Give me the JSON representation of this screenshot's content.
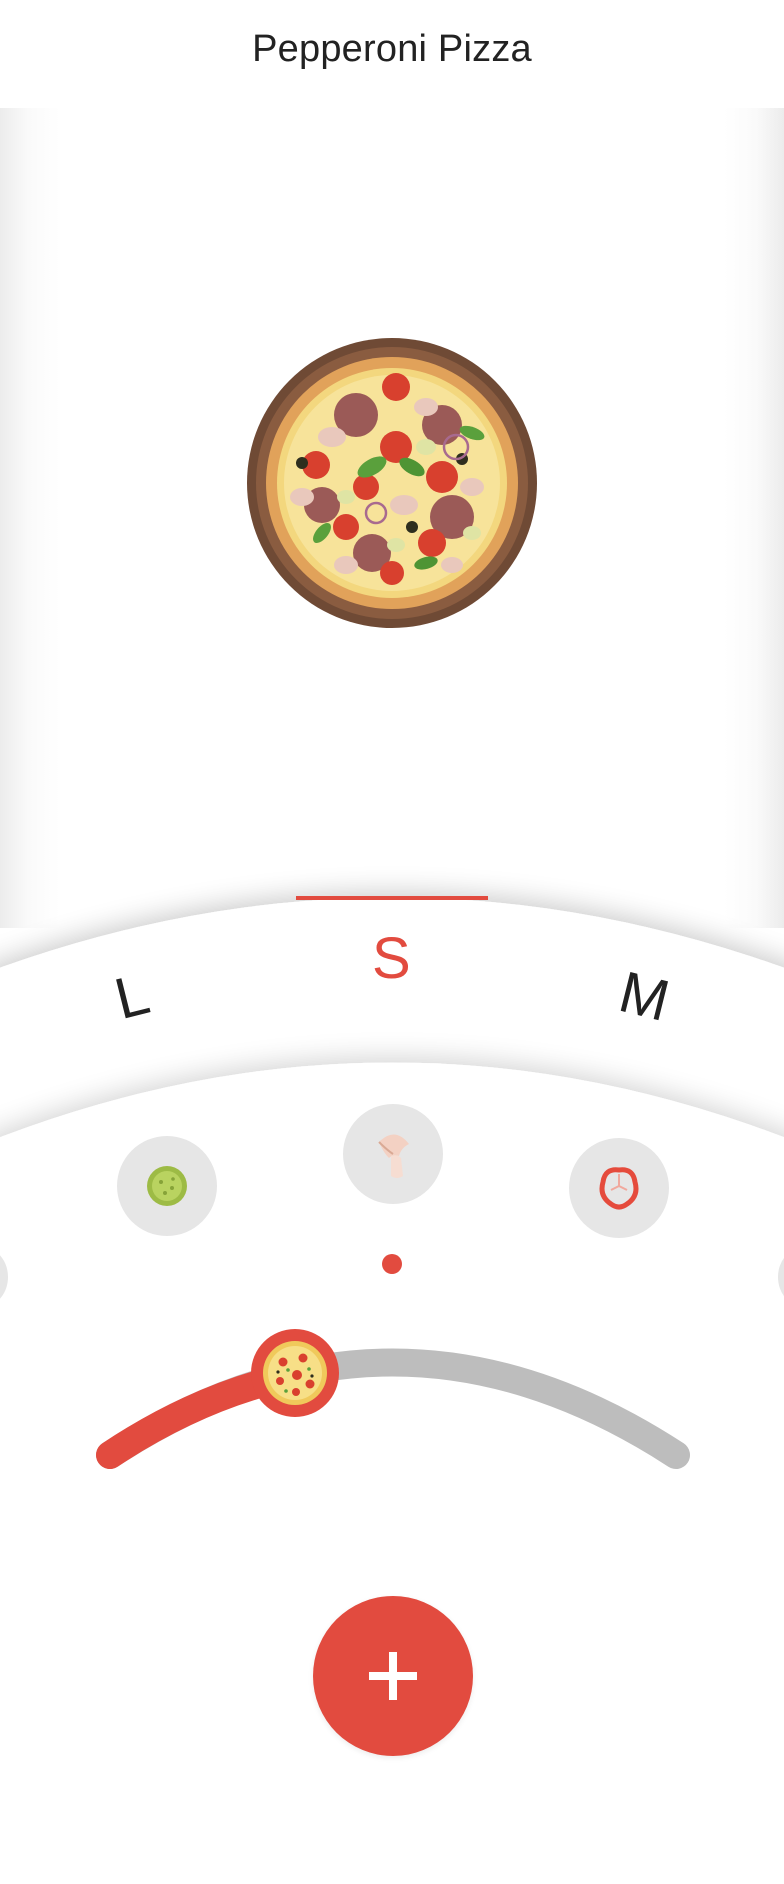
{
  "header": {
    "title": "Pepperoni Pizza"
  },
  "pizza": {
    "image_icon": "pizza-top-view-icon"
  },
  "sizes": {
    "items": [
      {
        "label": "L"
      },
      {
        "label": "S"
      },
      {
        "label": "M"
      }
    ],
    "selected": "S"
  },
  "toppings": {
    "items": [
      {
        "icon": "pickle-icon"
      },
      {
        "icon": "mushroom-icon"
      },
      {
        "icon": "pepper-icon"
      }
    ],
    "selected_index": 1
  },
  "slider": {
    "level": 0.33,
    "thumb_icon": "pizza-thumb-icon"
  },
  "add_button": {
    "icon": "plus-icon"
  },
  "colors": {
    "accent": "#e24b3f",
    "track": "#bdbdbd",
    "topping_bg": "#e6e6e6",
    "text": "#222222"
  }
}
